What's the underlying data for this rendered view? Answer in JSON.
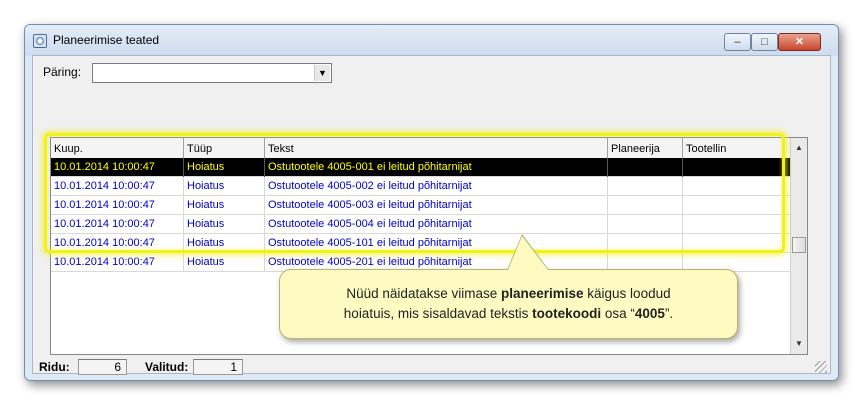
{
  "window": {
    "title": "Planeerimise teated",
    "controls": {
      "minimize": "–",
      "maximize": "□",
      "close": "✕"
    }
  },
  "query": {
    "label": "Päring:",
    "value": "",
    "dropdown_arrow": "▼"
  },
  "grid": {
    "columns": [
      "Kuup.",
      "Tüüp",
      "Tekst",
      "Planeerija",
      "Tootellin"
    ],
    "rows": [
      {
        "date": "10.01.2014 10:00:47",
        "type": "Hoiatus",
        "text": "Ostutootele 4005-001 ei leitud põhitarnijat",
        "planner": "",
        "line": ""
      },
      {
        "date": "10.01.2014 10:00:47",
        "type": "Hoiatus",
        "text": "Ostutootele 4005-002 ei leitud põhitarnijat",
        "planner": "",
        "line": ""
      },
      {
        "date": "10.01.2014 10:00:47",
        "type": "Hoiatus",
        "text": "Ostutootele 4005-003 ei leitud põhitarnijat",
        "planner": "",
        "line": ""
      },
      {
        "date": "10.01.2014 10:00:47",
        "type": "Hoiatus",
        "text": "Ostutootele 4005-004 ei leitud põhitarnijat",
        "planner": "",
        "line": ""
      },
      {
        "date": "10.01.2014 10:00:47",
        "type": "Hoiatus",
        "text": "Ostutootele 4005-101 ei leitud põhitarnijat",
        "planner": "",
        "line": ""
      },
      {
        "date": "10.01.2014 10:00:47",
        "type": "Hoiatus",
        "text": "Ostutootele 4005-201 ei leitud põhitarnijat",
        "planner": "",
        "line": ""
      }
    ],
    "selected_row": 0,
    "scroll_up": "▲",
    "scroll_down": "▼"
  },
  "callout": {
    "line1_pre": "Nüüd näidatakse viimase ",
    "line1_bold": "planeerimise",
    "line1_post": " käigus loodud",
    "line2_pre": "hoiatuis, mis sisaldavad tekstis ",
    "line2_bold1": "tootekoodi",
    "line2_mid": " osa “",
    "line2_bold2": "4005",
    "line2_post": "”."
  },
  "status": {
    "rows_label": "Ridu:",
    "rows_value": "6",
    "selected_label": "Valitud:",
    "selected_value": "1"
  },
  "colors": {
    "highlight": "#f0f21a",
    "row_text": "#0000c8",
    "selected_row_bg": "#000000",
    "selected_row_text": "#ffff00",
    "callout_bg": "#fdfbc2"
  }
}
